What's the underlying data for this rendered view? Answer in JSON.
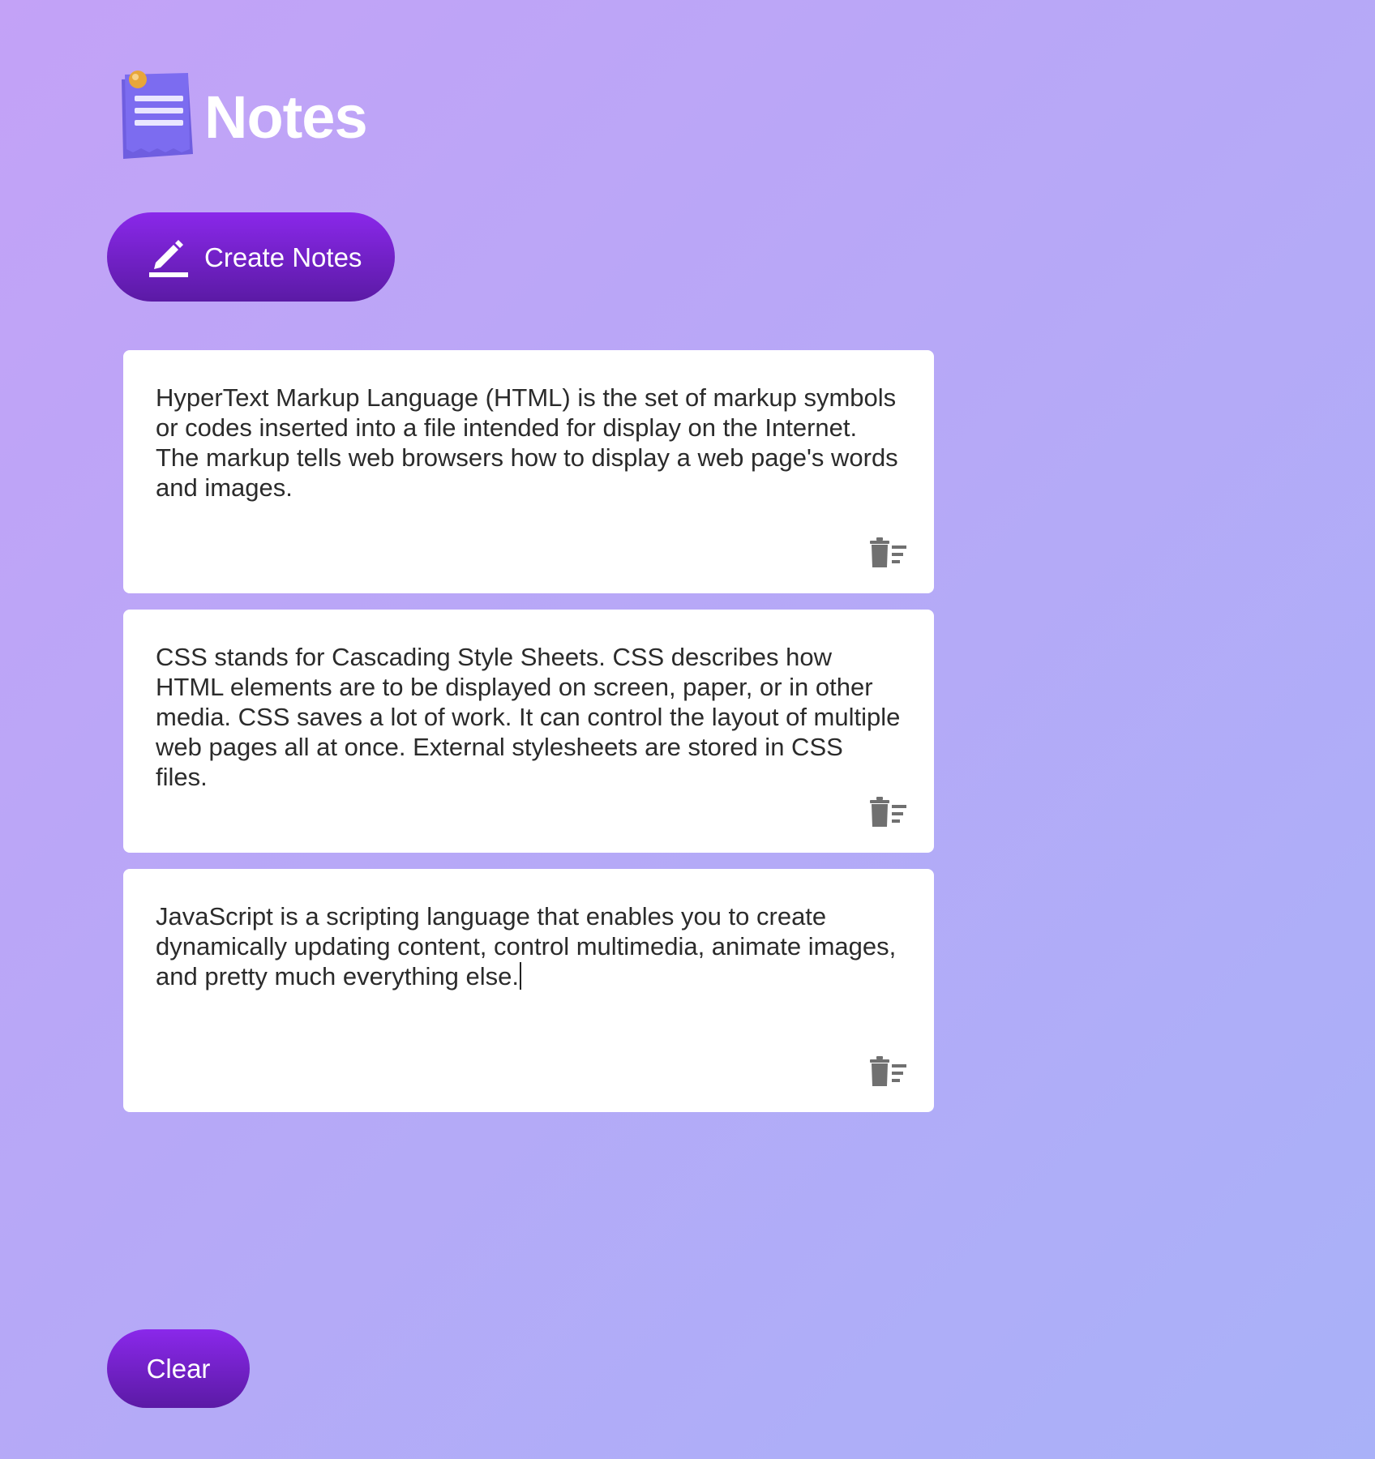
{
  "app": {
    "title": "Notes",
    "logo_icon": "notepad-pin-icon",
    "accent_color": "#7a22d6"
  },
  "toolbar": {
    "create_label": "Create Notes",
    "create_icon": "edit-pencil-icon"
  },
  "notes": [
    {
      "text": "HyperText Markup Language (HTML) is the set of markup symbols or codes inserted into a file intended for display on the Internet. The markup tells web browsers how to display a web page's words and images.",
      "delete_icon": "trash-delete-icon"
    },
    {
      "text": "CSS stands for Cascading Style Sheets. CSS describes how HTML elements are to be displayed on screen, paper, or in other media. CSS saves a lot of work. It can control the layout of multiple web pages all at once. External stylesheets are stored in CSS files.",
      "delete_icon": "trash-delete-icon"
    },
    {
      "text": "JavaScript is a scripting language that enables you to create dynamically updating content, control multimedia, animate images, and pretty much everything else.",
      "delete_icon": "trash-delete-icon"
    }
  ],
  "footer": {
    "clear_label": "Clear"
  }
}
